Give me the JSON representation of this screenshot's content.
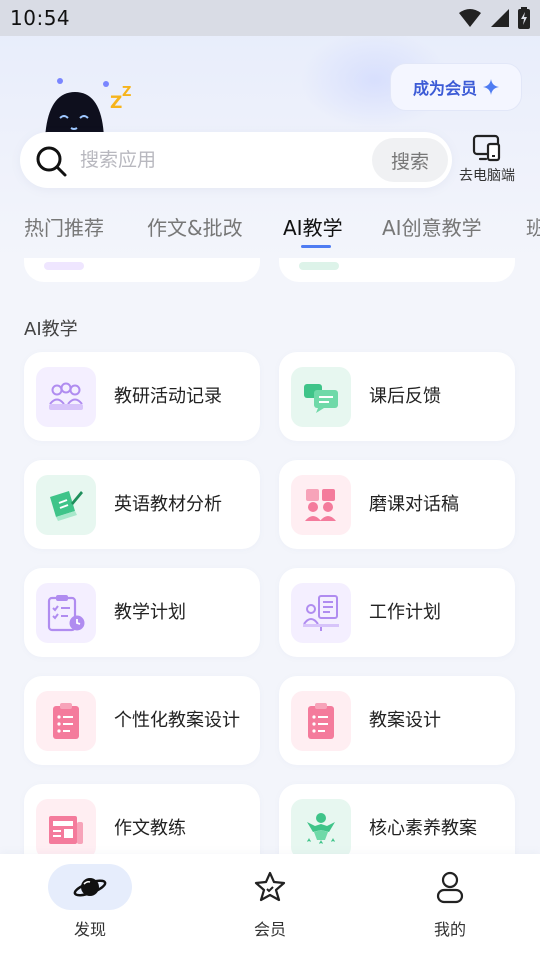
{
  "status_bar": {
    "time": "10:54"
  },
  "header": {
    "member_button_label": "成为会员",
    "desktop_link_label": "去电脑端"
  },
  "search": {
    "placeholder": "搜索应用",
    "button_label": "搜索"
  },
  "tabs": [
    {
      "label": "热门推荐"
    },
    {
      "label": "作文&批改"
    },
    {
      "label": "AI教学",
      "active": true
    },
    {
      "label": "AI创意教学"
    },
    {
      "label": "班"
    }
  ],
  "section": {
    "title": "AI教学",
    "items": [
      {
        "label": "教研活动记录",
        "icon": "team-meeting-icon",
        "color": "#b08cf0"
      },
      {
        "label": "课后反馈",
        "icon": "chat-feedback-icon",
        "color": "#3fc489"
      },
      {
        "label": "英语教材分析",
        "icon": "book-analysis-icon",
        "color": "#3fc489"
      },
      {
        "label": "磨课对话稿",
        "icon": "dialogue-script-icon",
        "color": "#f47b9c"
      },
      {
        "label": "教学计划",
        "icon": "checklist-clock-icon",
        "color": "#b08cf0"
      },
      {
        "label": "工作计划",
        "icon": "work-plan-icon",
        "color": "#b08cf0"
      },
      {
        "label": "个性化教案设计",
        "icon": "clipboard-icon",
        "color": "#f47b9c"
      },
      {
        "label": "教案设计",
        "icon": "clipboard-icon",
        "color": "#f47b9c"
      },
      {
        "label": "作文教练",
        "icon": "newspaper-icon",
        "color": "#f47b9c"
      },
      {
        "label": "核心素养教案",
        "icon": "achievement-icon",
        "color": "#3fc489"
      }
    ]
  },
  "bottom_nav": [
    {
      "label": "发现",
      "icon": "planet-icon",
      "active": true
    },
    {
      "label": "会员",
      "icon": "star-badge-icon"
    },
    {
      "label": "我的",
      "icon": "user-icon"
    }
  ],
  "colors": {
    "accent": "#4f7cf2",
    "member_text": "#3c5bd6"
  }
}
